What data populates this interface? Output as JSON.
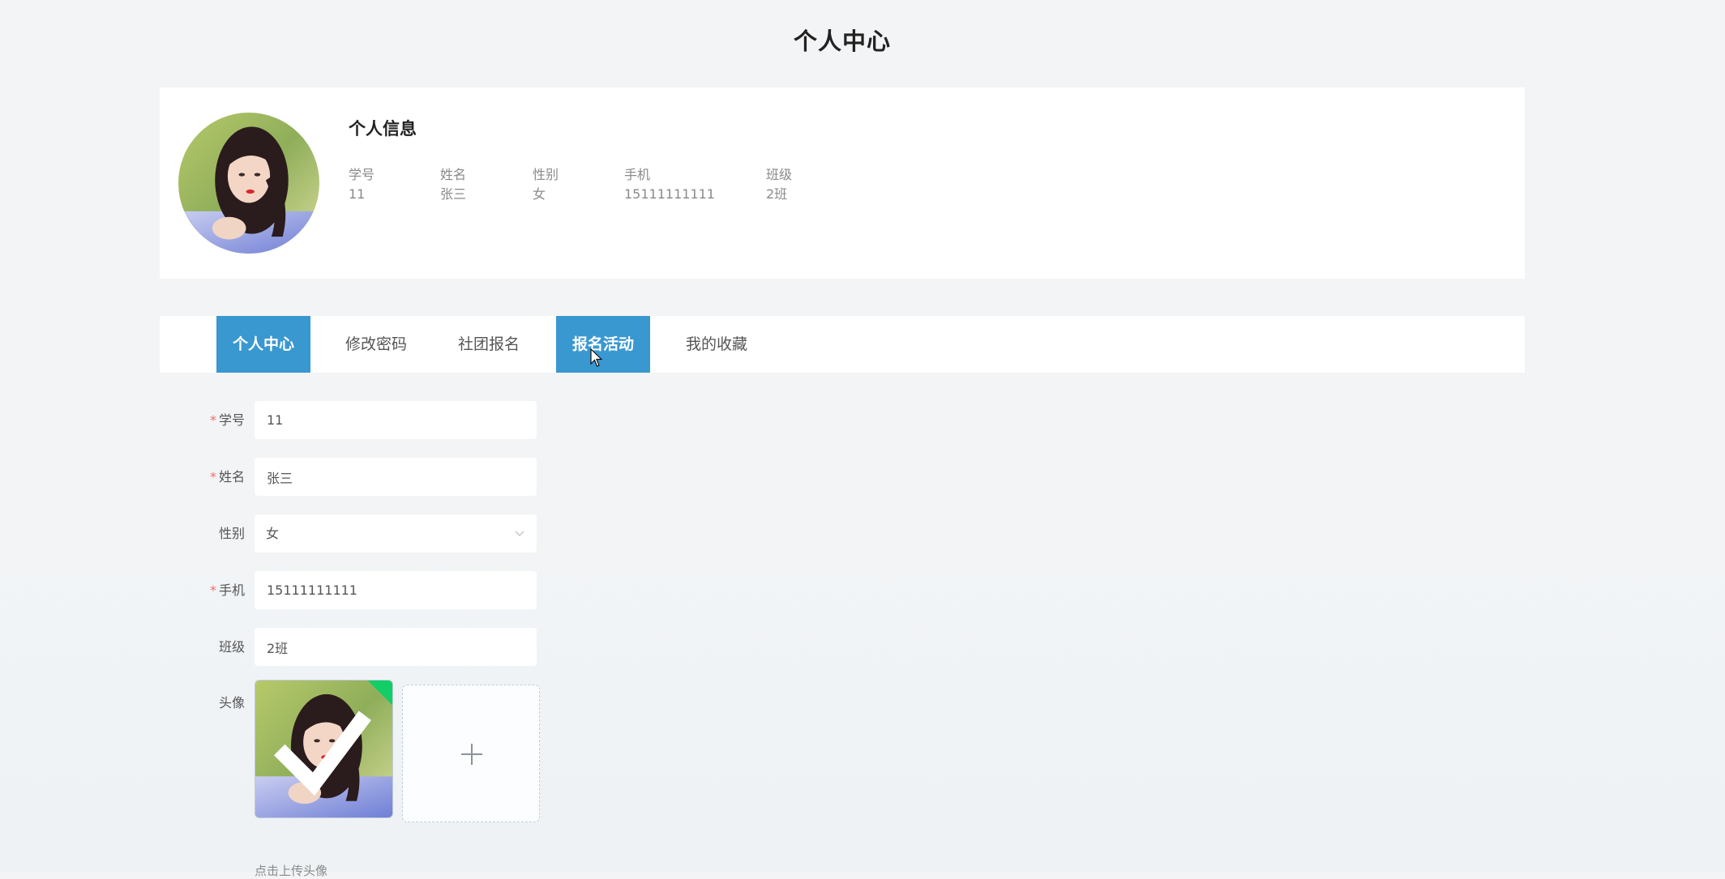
{
  "page": {
    "title": "个人中心"
  },
  "profile": {
    "heading": "个人信息",
    "fields": [
      {
        "label": "学号",
        "value": "11"
      },
      {
        "label": "姓名",
        "value": "张三"
      },
      {
        "label": "性别",
        "value": "女"
      },
      {
        "label": "手机",
        "value": "15111111111"
      },
      {
        "label": "班级",
        "value": "2班"
      }
    ]
  },
  "tabs": [
    {
      "label": "个人中心",
      "active": true
    },
    {
      "label": "修改密码",
      "active": false
    },
    {
      "label": "社团报名",
      "active": false
    },
    {
      "label": "报名活动",
      "active": true
    },
    {
      "label": "我的收藏",
      "active": false
    }
  ],
  "form": {
    "student_id": {
      "label": "学号",
      "required": "*",
      "value": "11"
    },
    "name": {
      "label": "姓名",
      "required": "*",
      "value": "张三"
    },
    "gender": {
      "label": "性别",
      "value": "女"
    },
    "phone": {
      "label": "手机",
      "required": "*",
      "value": "15111111111"
    },
    "class": {
      "label": "班级",
      "value": "2班"
    },
    "avatar": {
      "label": "头像",
      "tip": "点击上传头像"
    }
  },
  "colors": {
    "accent": "#3a98d1",
    "required": "#f56c6c",
    "success": "#13ce66"
  },
  "icons": {
    "select_arrow": "chevron-down-icon",
    "upload_success": "check-icon",
    "upload_add": "plus-icon",
    "pointer": "mouse-cursor-icon"
  }
}
